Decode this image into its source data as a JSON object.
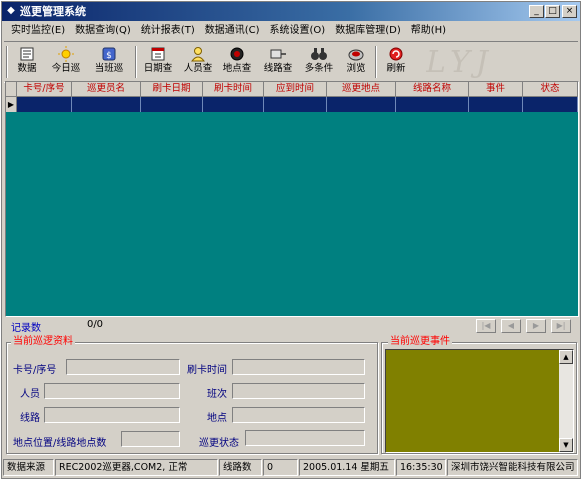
{
  "window": {
    "title": "巡更管理系统",
    "controls": {
      "minimize": "_",
      "maximize": "□",
      "close": "×"
    }
  },
  "menu": {
    "items": [
      "实时监控(E)",
      "数据查询(Q)",
      "统计报表(T)",
      "数据通讯(C)",
      "系统设置(O)",
      "数据库管理(D)",
      "帮助(H)"
    ]
  },
  "toolbar": {
    "buttons": [
      {
        "label": "数据",
        "icon": "data-icon"
      },
      {
        "label": "今日巡",
        "icon": "sun-icon"
      },
      {
        "label": "当班巡",
        "icon": "shift-icon"
      },
      {
        "label": "日期查",
        "icon": "calendar-icon"
      },
      {
        "label": "人员查",
        "icon": "person-icon"
      },
      {
        "label": "地点查",
        "icon": "location-icon"
      },
      {
        "label": "线路查",
        "icon": "route-icon"
      },
      {
        "label": "多条件",
        "icon": "binoculars-icon"
      },
      {
        "label": "浏览",
        "icon": "browse-icon"
      },
      {
        "label": "刷新",
        "icon": "refresh-icon"
      }
    ],
    "watermark": "LYJ"
  },
  "grid": {
    "columns": [
      "卡号/序号",
      "巡更员名",
      "刷卡日期",
      "刷卡时间",
      "应到时间",
      "巡更地点",
      "线路名称",
      "事件",
      "状态"
    ],
    "row_indicator": "▶"
  },
  "records": {
    "label": "记录数",
    "value": "0/0"
  },
  "details": {
    "title": "当前巡逻资料",
    "fields": {
      "card": "卡号/序号",
      "swipe_time": "刷卡时间",
      "person": "人员",
      "shift": "班次",
      "route": "线路",
      "location": "地点",
      "location_pos": "地点位置/线路地点数",
      "patrol_status": "巡更状态"
    }
  },
  "event_panel": {
    "title": "当前巡更事件"
  },
  "statusbar": {
    "source_label": "数据来源",
    "source_value": "REC2002巡更器,COM2, 正常",
    "route_count_label": "线路数",
    "route_count_value": "0",
    "date": "2005.01.14 星期五",
    "time": "16:35:30",
    "company": "深圳市饶兴智能科技有限公司"
  },
  "colors": {
    "grid_bg": "#008080",
    "header_text": "#c00000",
    "selected_row": "#0a246a",
    "group_title": "#ff0000",
    "event_bg": "#808000",
    "titlebar": "#0a246a"
  }
}
